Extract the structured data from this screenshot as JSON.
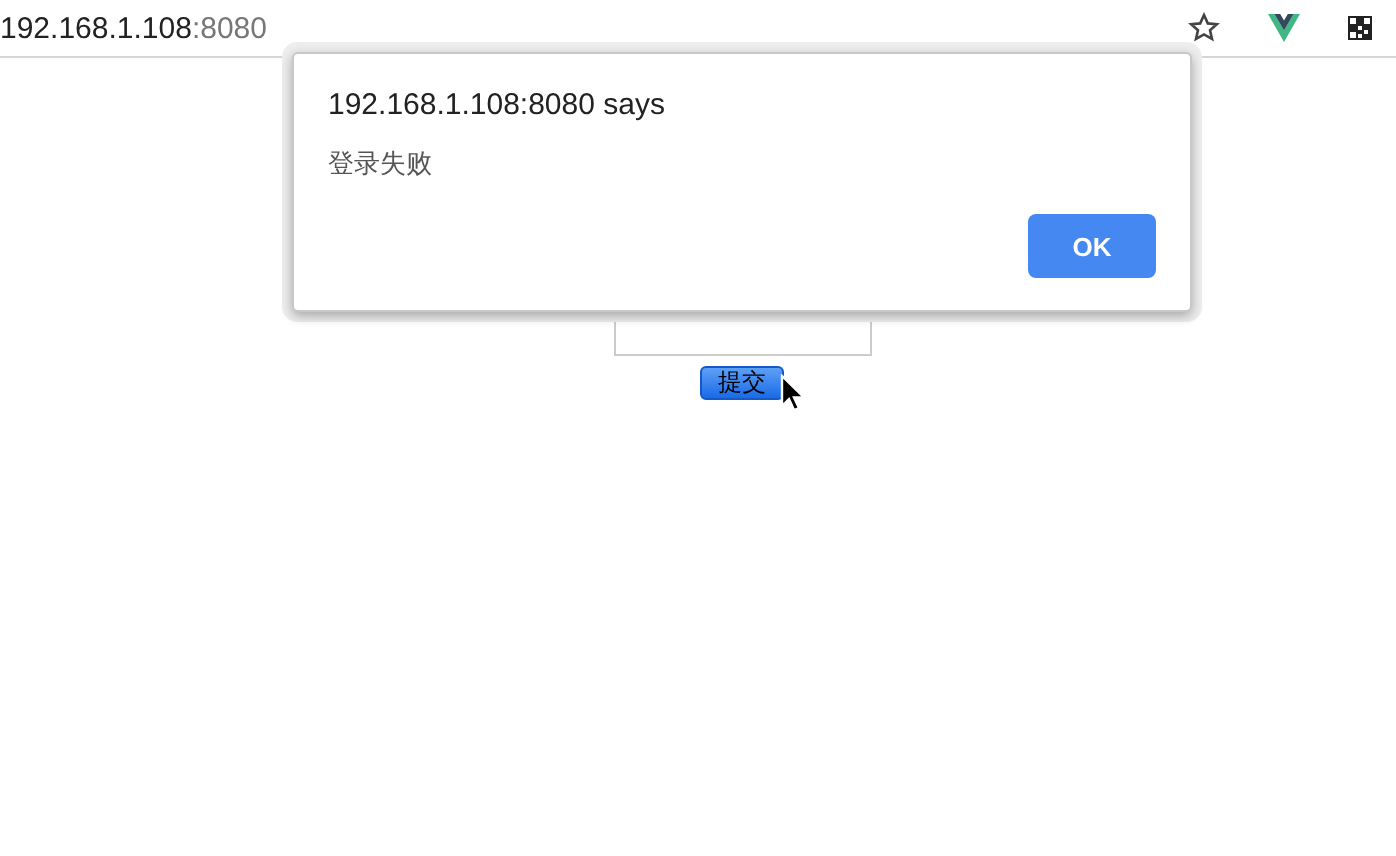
{
  "address_bar": {
    "host": "192.168.1.108",
    "port": ":8080"
  },
  "page": {
    "submit_button": "提交"
  },
  "alert": {
    "title": "192.168.1.108:8080 says",
    "message": "登录失败",
    "buttons": [
      "OK"
    ]
  }
}
